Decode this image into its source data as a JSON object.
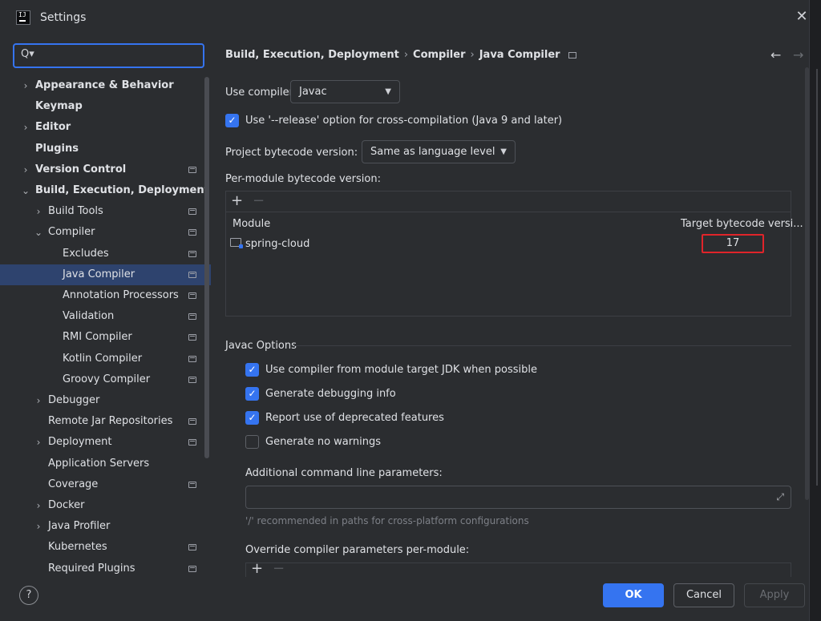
{
  "window": {
    "title": "Settings"
  },
  "search": {
    "placeholder": ""
  },
  "tree": [
    {
      "label": "Appearance & Behavior",
      "chevron": "right",
      "bold": true,
      "indent": 0,
      "project": false,
      "selected": false
    },
    {
      "label": "Keymap",
      "chevron": "",
      "bold": true,
      "indent": 0,
      "project": false,
      "selected": false
    },
    {
      "label": "Editor",
      "chevron": "right",
      "bold": true,
      "indent": 0,
      "project": false,
      "selected": false
    },
    {
      "label": "Plugins",
      "chevron": "",
      "bold": true,
      "indent": 0,
      "project": false,
      "selected": false
    },
    {
      "label": "Version Control",
      "chevron": "right",
      "bold": true,
      "indent": 0,
      "project": true,
      "selected": false
    },
    {
      "label": "Build, Execution, Deployment",
      "chevron": "down",
      "bold": true,
      "indent": 0,
      "project": false,
      "selected": false
    },
    {
      "label": "Build Tools",
      "chevron": "right",
      "bold": false,
      "indent": 1,
      "project": true,
      "selected": false
    },
    {
      "label": "Compiler",
      "chevron": "down",
      "bold": false,
      "indent": 1,
      "project": true,
      "selected": false
    },
    {
      "label": "Excludes",
      "chevron": "",
      "bold": false,
      "indent": 2,
      "project": true,
      "selected": false
    },
    {
      "label": "Java Compiler",
      "chevron": "",
      "bold": false,
      "indent": 2,
      "project": true,
      "selected": true
    },
    {
      "label": "Annotation Processors",
      "chevron": "",
      "bold": false,
      "indent": 2,
      "project": true,
      "selected": false
    },
    {
      "label": "Validation",
      "chevron": "",
      "bold": false,
      "indent": 2,
      "project": true,
      "selected": false
    },
    {
      "label": "RMI Compiler",
      "chevron": "",
      "bold": false,
      "indent": 2,
      "project": true,
      "selected": false
    },
    {
      "label": "Kotlin Compiler",
      "chevron": "",
      "bold": false,
      "indent": 2,
      "project": true,
      "selected": false
    },
    {
      "label": "Groovy Compiler",
      "chevron": "",
      "bold": false,
      "indent": 2,
      "project": true,
      "selected": false
    },
    {
      "label": "Debugger",
      "chevron": "right",
      "bold": false,
      "indent": 1,
      "project": false,
      "selected": false
    },
    {
      "label": "Remote Jar Repositories",
      "chevron": "",
      "bold": false,
      "indent": 1,
      "project": true,
      "selected": false
    },
    {
      "label": "Deployment",
      "chevron": "right",
      "bold": false,
      "indent": 1,
      "project": true,
      "selected": false
    },
    {
      "label": "Application Servers",
      "chevron": "",
      "bold": false,
      "indent": 1,
      "project": false,
      "selected": false
    },
    {
      "label": "Coverage",
      "chevron": "",
      "bold": false,
      "indent": 1,
      "project": true,
      "selected": false
    },
    {
      "label": "Docker",
      "chevron": "right",
      "bold": false,
      "indent": 1,
      "project": false,
      "selected": false
    },
    {
      "label": "Java Profiler",
      "chevron": "right",
      "bold": false,
      "indent": 1,
      "project": false,
      "selected": false
    },
    {
      "label": "Kubernetes",
      "chevron": "",
      "bold": false,
      "indent": 1,
      "project": true,
      "selected": false
    },
    {
      "label": "Required Plugins",
      "chevron": "",
      "bold": false,
      "indent": 1,
      "project": true,
      "selected": false
    }
  ],
  "breadcrumb": {
    "part1": "Build, Execution, Deployment",
    "part2": "Compiler",
    "part3": "Java Compiler",
    "sep": "›"
  },
  "main": {
    "use_compiler_label": "Use compiler:",
    "use_compiler_value": "Javac",
    "release_option_label": "Use '--release' option for cross-compilation (Java 9 and later)",
    "release_option_checked": true,
    "bytecode_label": "Project bytecode version:",
    "bytecode_value": "Same as language level",
    "per_module_label": "Per-module bytecode version:",
    "table": {
      "col_module": "Module",
      "col_target": "Target bytecode versi...",
      "rows": [
        {
          "module": "spring-cloud",
          "target": "17"
        }
      ]
    },
    "javac_section": "Javac Options",
    "options": [
      {
        "label": "Use compiler from module target JDK when possible",
        "checked": true
      },
      {
        "label": "Generate debugging info",
        "checked": true
      },
      {
        "label": "Report use of deprecated features",
        "checked": true
      },
      {
        "label": "Generate no warnings",
        "checked": false
      }
    ],
    "additional_params_label": "Additional command line parameters:",
    "additional_params_value": "",
    "hint": "'/' recommended in paths for cross-platform configurations",
    "override_label": "Override compiler parameters per-module:"
  },
  "buttons": {
    "ok": "OK",
    "cancel": "Cancel",
    "apply": "Apply",
    "help": "?"
  },
  "colors": {
    "accent": "#3574f0",
    "selection": "#2e436e",
    "highlight_box": "#e0242a",
    "background": "#2b2d30"
  }
}
